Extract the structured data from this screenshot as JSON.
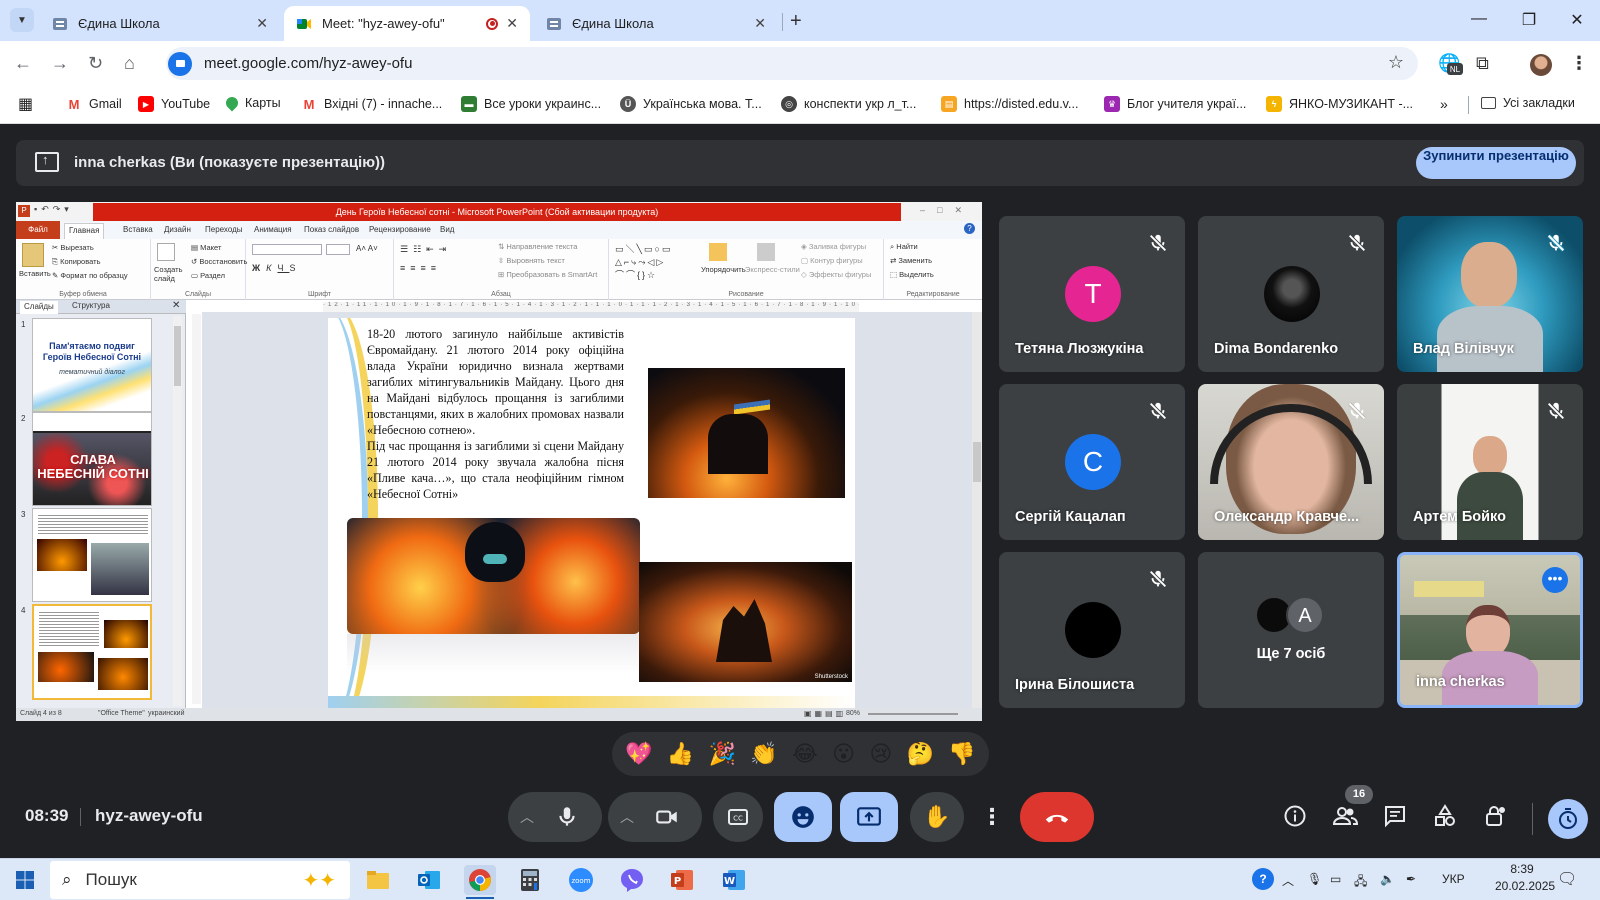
{
  "browser": {
    "tabs": [
      {
        "title": "Єдина Школа",
        "favicon": "ednaschool-icon",
        "active": false
      },
      {
        "title": "Meet: \"hyz-awey-ofu\"",
        "favicon": "google-meet-icon",
        "active": true,
        "recording": true
      },
      {
        "title": "Єдина Школа",
        "favicon": "ednaschool-icon",
        "active": false
      }
    ],
    "url": "meet.google.com/hyz-awey-ofu",
    "profile_badge": "NL",
    "bookmarks": [
      {
        "label": "Gmail",
        "icon": "gmail-icon",
        "color": "#ea4335"
      },
      {
        "label": "YouTube",
        "icon": "youtube-icon",
        "color": "#ff0000"
      },
      {
        "label": "Карты",
        "icon": "maps-pin-icon",
        "color": "#34a853"
      },
      {
        "label": "Вхідні (7) - innache...",
        "icon": "gmail-icon",
        "color": "#ea4335"
      },
      {
        "label": "Все уроки украинс...",
        "icon": "book-icon",
        "color": "#2e7d32"
      },
      {
        "label": "Українська мова. Т...",
        "icon": "site-icon",
        "color": "#555555"
      },
      {
        "label": "конспекти укр л_т...",
        "icon": "globe-icon",
        "color": "#444444"
      },
      {
        "label": "https://disted.edu.v...",
        "icon": "folder-icon",
        "color": "#f6a623"
      },
      {
        "label": "Блог учителя украї...",
        "icon": "blog-icon",
        "color": "#9c27b0"
      },
      {
        "label": "ЯНКО-МУЗИКАНТ -...",
        "icon": "bolt-icon",
        "color": "#f4b400"
      }
    ],
    "all_bookmarks": "Усі закладки"
  },
  "meet": {
    "presenting_text": "inna cherkas (Ви (показуєте презентацію))",
    "stop_button": "Зупинити презентацію",
    "time": "08:39",
    "meeting_code": "hyz-awey-ofu",
    "participants_count": "16",
    "reactions": [
      "💖",
      "👍",
      "🎉",
      "👏",
      "😂",
      "😮",
      "😢",
      "🤔",
      "👎"
    ],
    "participants": [
      {
        "name": "Тетяна Люзжукіна",
        "type": "letter",
        "letter": "T",
        "color": "#e52592",
        "muted": true
      },
      {
        "name": "Dima Bondarenko",
        "type": "photo",
        "muted": true
      },
      {
        "name": "Влад Вілівчук",
        "type": "video",
        "muted": true
      },
      {
        "name": "Сергій Кацалап",
        "type": "letter",
        "letter": "C",
        "color": "#1a73e8",
        "muted": true
      },
      {
        "name": "Олександр Кравче...",
        "type": "video",
        "muted": true
      },
      {
        "name": "Артем Бойко",
        "type": "video",
        "muted": true
      },
      {
        "name": "Ірина Білошиста",
        "type": "photo",
        "muted": true
      },
      {
        "name": "Ще 7 осіб",
        "type": "more",
        "letter": "A"
      },
      {
        "name": "inna cherkas",
        "type": "video",
        "self": true
      }
    ]
  },
  "powerpoint": {
    "title": "День Героїв Небесної сотні - Microsoft PowerPoint (Сбой активации продукта)",
    "file_tab": "Файл",
    "tabs": [
      "Главная",
      "Вставка",
      "Дизайн",
      "Переходы",
      "Анимация",
      "Показ слайдов",
      "Рецензирование",
      "Вид"
    ],
    "groups": [
      "Буфер обмена",
      "Слайды",
      "Шрифт",
      "Абзац",
      "Рисование",
      "Редактирование"
    ],
    "clipboard": {
      "paste": "Вставить",
      "cut": "Вырезать",
      "copy": "Копировать",
      "format": "Формат по образцу"
    },
    "slides_group": {
      "create": "Создать слайд",
      "layout": "Макет",
      "reset": "Восстановить",
      "section": "Раздел"
    },
    "paragraph": {
      "direction": "Направление текста",
      "align": "Выровнять текст",
      "smartart": "Преобразовать в SmartArt"
    },
    "drawing": {
      "arrange": "Упорядочить",
      "quick_styles": "Экспресс-стили",
      "fill": "Заливка фигуры",
      "outline": "Контур фигуры",
      "effects": "Эффекты фигуры"
    },
    "editing": {
      "find": "Найти",
      "replace": "Заменить",
      "select": "Выделить"
    },
    "panel_tabs": [
      "Слайды",
      "Структура"
    ],
    "thumb1_title": "Пам'ятаємо подвиг Героїв Небесної Сотні",
    "thumb1_sub": "тематичний діалог",
    "thumb2_text": "СЛАВА НЕБЕСНІЙ СОТНІ",
    "slide_para1": "18-20 лютого загинуло найбільше активістів Євромайдану. 21 лютого 2014 року офіційна влада України юридично визнала жертвами загиблих мітингувальників Майдану. Цього дня на Майдані відбулось прощання із загиблими повстанцями, яких в жалобних промовах назвали «Небесною сотнею».",
    "slide_para2": "Під час прощання із загиблими зі сцени Майдану 21 лютого 2014 року звучала жалобна пісня «Пливе кача…», що стала неофіційним гімном «Небесної Сотні»",
    "shutterstock": "Shutterstock",
    "status": {
      "slide": "Слайд 4 из 8",
      "theme": "\"Office Theme\"",
      "lang": "украинский",
      "zoom": "80%"
    }
  },
  "taskbar": {
    "search_placeholder": "Пошук",
    "lang": "УКР",
    "time": "8:39",
    "date": "20.02.2025"
  }
}
